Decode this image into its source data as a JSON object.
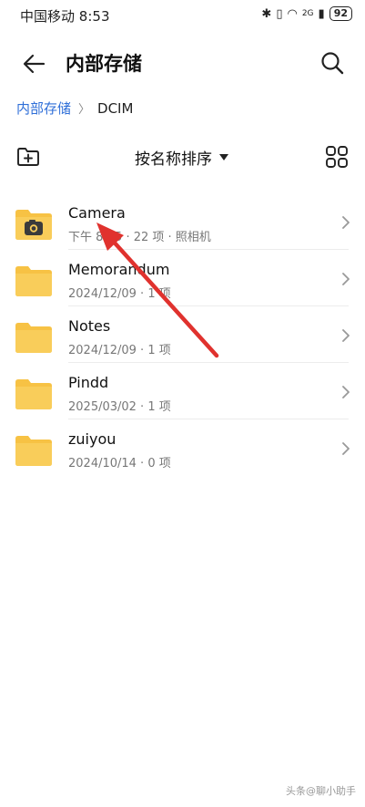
{
  "status": {
    "carrier": "中国移动",
    "time": "8:53",
    "network": "2G",
    "battery": "92"
  },
  "header": {
    "title": "内部存储"
  },
  "breadcrumb": {
    "root": "内部存储",
    "current": "DCIM"
  },
  "toolbar": {
    "sort_label": "按名称排序"
  },
  "folders": [
    {
      "name": "Camera",
      "meta": "下午 8:35 · 22 项 · 照相机",
      "icon": "camera-folder-icon"
    },
    {
      "name": "Memorandum",
      "meta": "2024/12/09 · 1 项",
      "icon": "folder-icon"
    },
    {
      "name": "Notes",
      "meta": "2024/12/09 · 1 项",
      "icon": "folder-icon"
    },
    {
      "name": "Pindd",
      "meta": "2025/03/02 · 1 项",
      "icon": "folder-icon"
    },
    {
      "name": "zuiyou",
      "meta": "2024/10/14 · 0 项",
      "icon": "folder-icon"
    }
  ],
  "colors": {
    "folder": "#f7c244",
    "folder_dark": "#eeb22e",
    "accent": "#2f6fd8",
    "annotation_arrow": "#e0322e"
  },
  "watermark": "头条@聊小助手"
}
